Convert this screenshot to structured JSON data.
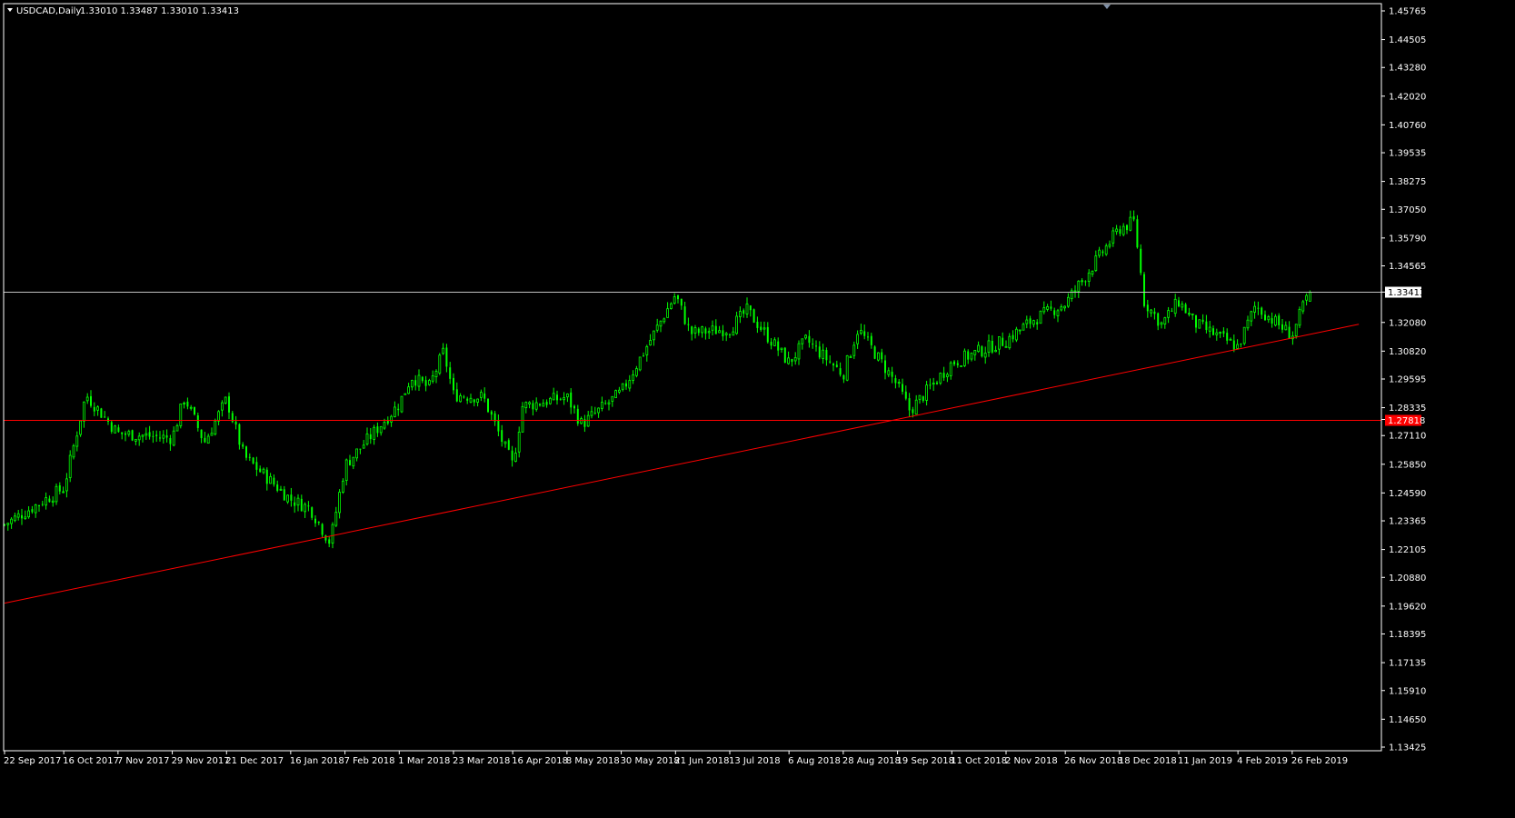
{
  "window": {
    "symbol_label": "USDCAD,Daily",
    "ohlc_label": "1.33010 1.33487 1.33010 1.33413"
  },
  "colors": {
    "background": "#000000",
    "frame": "#ffffff",
    "candle": "#00ff00",
    "trendline": "#ff0000",
    "hline_current": "#c0c0c0",
    "hline_level": "#ff0000"
  },
  "chart_data": {
    "type": "candlestick",
    "symbol": "USDCAD",
    "timeframe": "Daily",
    "last_ohlc": {
      "open": 1.3301,
      "high": 1.33487,
      "low": 1.3301,
      "close": 1.33413
    },
    "ylim": [
      1.13425,
      1.45765
    ],
    "y_ticks": [
      "1.45765",
      "1.44505",
      "1.43280",
      "1.42020",
      "1.40760",
      "1.39535",
      "1.38275",
      "1.37050",
      "1.35790",
      "1.34565",
      "1.33413",
      "1.32080",
      "1.30820",
      "1.29595",
      "1.28335",
      "1.27818",
      "1.27110",
      "1.25850",
      "1.24590",
      "1.23365",
      "1.22105",
      "1.20880",
      "1.19620",
      "1.18395",
      "1.17135",
      "1.15910",
      "1.14650",
      "1.13425"
    ],
    "x_labels": [
      "22 Sep 2017",
      "16 Oct 2017",
      "7 Nov 2017",
      "29 Nov 2017",
      "21 Dec 2017",
      "16 Jan 2018",
      "7 Feb 2018",
      "1 Mar 2018",
      "23 Mar 2018",
      "16 Apr 2018",
      "8 May 2018",
      "30 May 2018",
      "21 Jun 2018",
      "13 Jul 2018",
      "6 Aug 2018",
      "28 Aug 2018",
      "19 Sep 2018",
      "11 Oct 2018",
      "2 Nov 2018",
      "26 Nov 2018",
      "18 Dec 2018",
      "11 Jan 2019",
      "4 Feb 2019",
      "26 Feb 2019"
    ],
    "close_path": [
      [
        "22 Sep 2017",
        1.232
      ],
      [
        "16 Oct 2017",
        1.248
      ],
      [
        "25 Oct 2017",
        1.289
      ],
      [
        "7 Nov 2017",
        1.272
      ],
      [
        "29 Nov 2017",
        1.27
      ],
      [
        "4 Dec 2017",
        1.288
      ],
      [
        "12 Dec 2017",
        1.268
      ],
      [
        "21 Dec 2017",
        1.287
      ],
      [
        "28 Dec 2017",
        1.262
      ],
      [
        "16 Jan 2018",
        1.243
      ],
      [
        "24 Jan 2018",
        1.239
      ],
      [
        "1 Feb 2018",
        1.224
      ],
      [
        "7 Feb 2018",
        1.258
      ],
      [
        "1 Mar 2018",
        1.285
      ],
      [
        "6 Mar 2018",
        1.297
      ],
      [
        "13 Mar 2018",
        1.292
      ],
      [
        "19 Mar 2018",
        1.308
      ],
      [
        "23 Mar 2018",
        1.289
      ],
      [
        "4 Apr 2018",
        1.288
      ],
      [
        "16 Apr 2018",
        1.258
      ],
      [
        "20 Apr 2018",
        1.284
      ],
      [
        "8 May 2018",
        1.288
      ],
      [
        "14 May 2018",
        1.276
      ],
      [
        "30 May 2018",
        1.29
      ],
      [
        "21 Jun 2018",
        1.333
      ],
      [
        "27 Jun 2018",
        1.316
      ],
      [
        "13 Jul 2018",
        1.318
      ],
      [
        "20 Jul 2018",
        1.326
      ],
      [
        "6 Aug 2018",
        1.303
      ],
      [
        "13 Aug 2018",
        1.313
      ],
      [
        "28 Aug 2018",
        1.298
      ],
      [
        "3 Sep 2018",
        1.318
      ],
      [
        "19 Sep 2018",
        1.293
      ],
      [
        "24 Sep 2018",
        1.282
      ],
      [
        "11 Oct 2018",
        1.303
      ],
      [
        "2 Nov 2018",
        1.313
      ],
      [
        "13 Nov 2018",
        1.322
      ],
      [
        "26 Nov 2018",
        1.329
      ],
      [
        "18 Dec 2018",
        1.362
      ],
      [
        "24 Dec 2018",
        1.365
      ],
      [
        "28 Dec 2018",
        1.33
      ],
      [
        "4 Jan 2019",
        1.32
      ],
      [
        "11 Jan 2019",
        1.33
      ],
      [
        "18 Jan 2019",
        1.32
      ],
      [
        "4 Feb 2019",
        1.31
      ],
      [
        "11 Feb 2019",
        1.328
      ],
      [
        "26 Feb 2019",
        1.315
      ],
      [
        "5 Mar 2019",
        1.335
      ]
    ],
    "trendline": {
      "start": [
        "22 Sep 2017",
        1.1975
      ],
      "end": [
        "25 Mar 2019",
        1.32
      ]
    },
    "hlines": [
      {
        "value": 1.33413,
        "label": "1.33413",
        "color": "#c0c0c0"
      },
      {
        "value": 1.27818,
        "label": "1.27818",
        "color": "#ff0000"
      }
    ],
    "grid": false
  }
}
